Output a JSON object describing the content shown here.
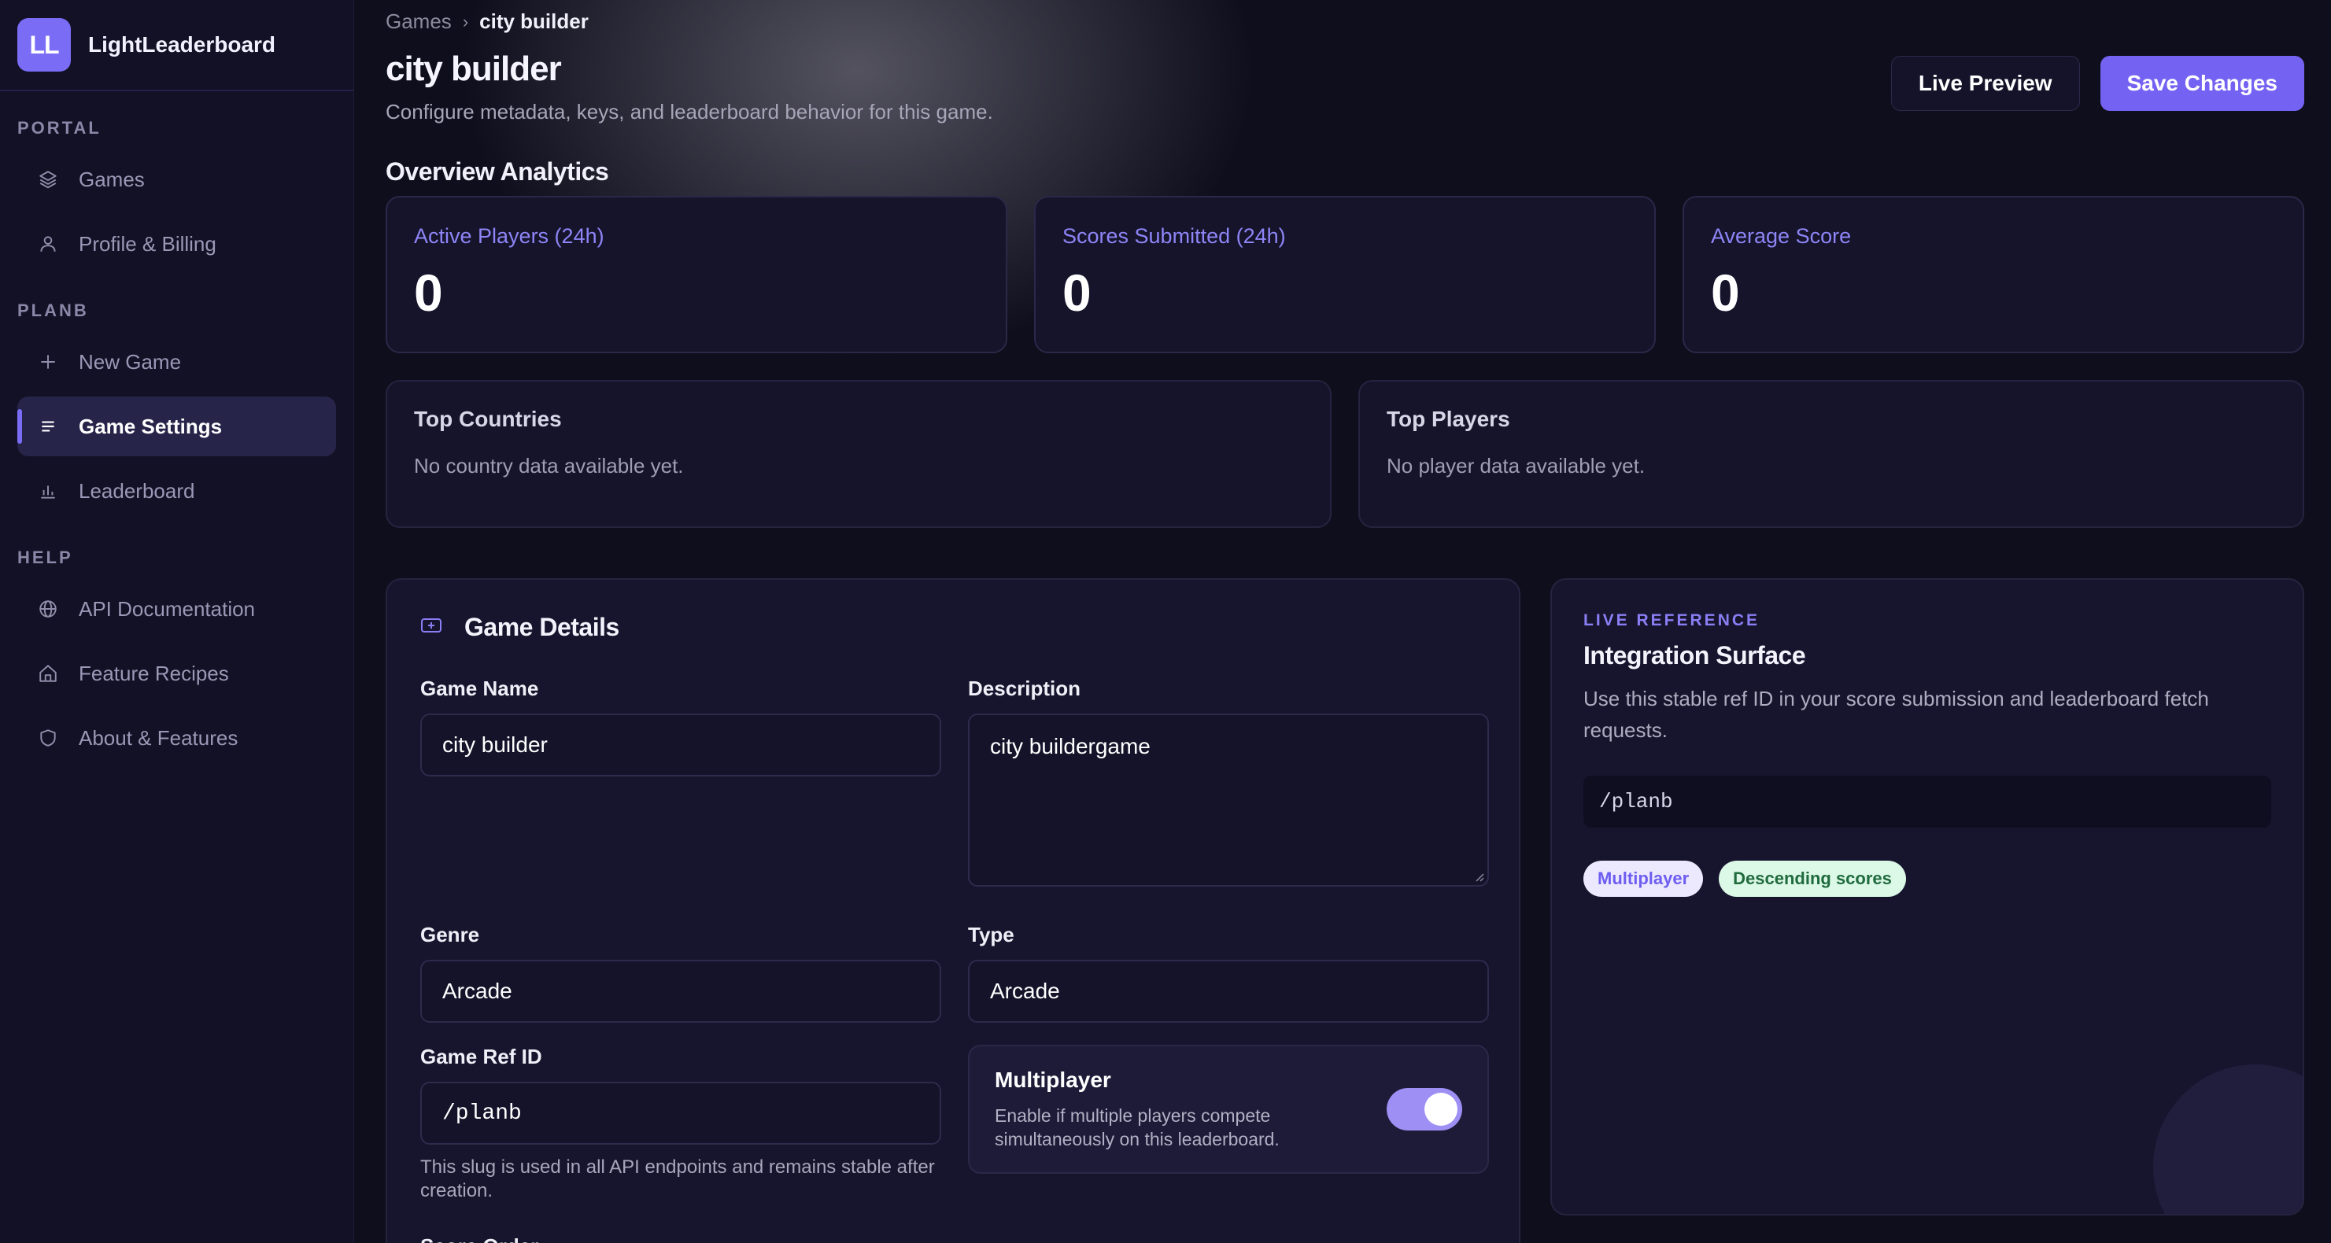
{
  "brand": {
    "logo": "LL",
    "name": "LightLeaderboard"
  },
  "sidebar": {
    "sections": [
      {
        "title": "PORTAL",
        "items": [
          {
            "label": "Games",
            "icon": "layers-icon"
          },
          {
            "label": "Profile & Billing",
            "icon": "user-icon"
          }
        ]
      },
      {
        "title": "PLANB",
        "items": [
          {
            "label": "New Game",
            "icon": "plus-icon"
          },
          {
            "label": "Game Settings",
            "icon": "lines-icon",
            "active": true
          },
          {
            "label": "Leaderboard",
            "icon": "bar-chart-icon"
          }
        ]
      },
      {
        "title": "HELP",
        "items": [
          {
            "label": "API Documentation",
            "icon": "globe-icon"
          },
          {
            "label": "Feature Recipes",
            "icon": "home-icon"
          },
          {
            "label": "About & Features",
            "icon": "shield-icon"
          }
        ]
      }
    ]
  },
  "breadcrumb": {
    "parent": "Games",
    "separator": "›",
    "current": "city builder"
  },
  "header": {
    "title": "city builder",
    "subtitle": "Configure metadata, keys, and leaderboard behavior for this game.",
    "live_preview_label": "Live Preview",
    "save_label": "Save Changes"
  },
  "analytics": {
    "title": "Overview Analytics",
    "stats": [
      {
        "label": "Active Players (24h)",
        "value": "0"
      },
      {
        "label": "Scores Submitted (24h)",
        "value": "0"
      },
      {
        "label": "Average Score",
        "value": "0"
      }
    ],
    "top_countries": {
      "title": "Top Countries",
      "empty": "No country data available yet."
    },
    "top_players": {
      "title": "Top Players",
      "empty": "No player data available yet."
    }
  },
  "details": {
    "title": "Game Details",
    "game_name": {
      "label": "Game Name",
      "value": "city builder"
    },
    "description": {
      "label": "Description",
      "value": "city buildergame"
    },
    "genre": {
      "label": "Genre",
      "value": "Arcade"
    },
    "type": {
      "label": "Type",
      "value": "Arcade"
    },
    "ref_id": {
      "label": "Game Ref ID",
      "value": "/planb",
      "help": "This slug is used in all API endpoints and remains stable after creation."
    },
    "multiplayer": {
      "title": "Multiplayer",
      "desc": "Enable if multiple players compete simultaneously on this leaderboard.",
      "enabled": true
    },
    "score_order": {
      "label": "Score Order"
    }
  },
  "reference": {
    "tag": "LIVE REFERENCE",
    "title": "Integration Surface",
    "desc": "Use this stable ref ID in your score submission and leaderboard fetch requests.",
    "code": "/planb",
    "pills": [
      "Multiplayer",
      "Descending scores"
    ]
  },
  "colors": {
    "accent": "#7463f2",
    "background": "#0f0e1c",
    "card": "#15142b"
  }
}
